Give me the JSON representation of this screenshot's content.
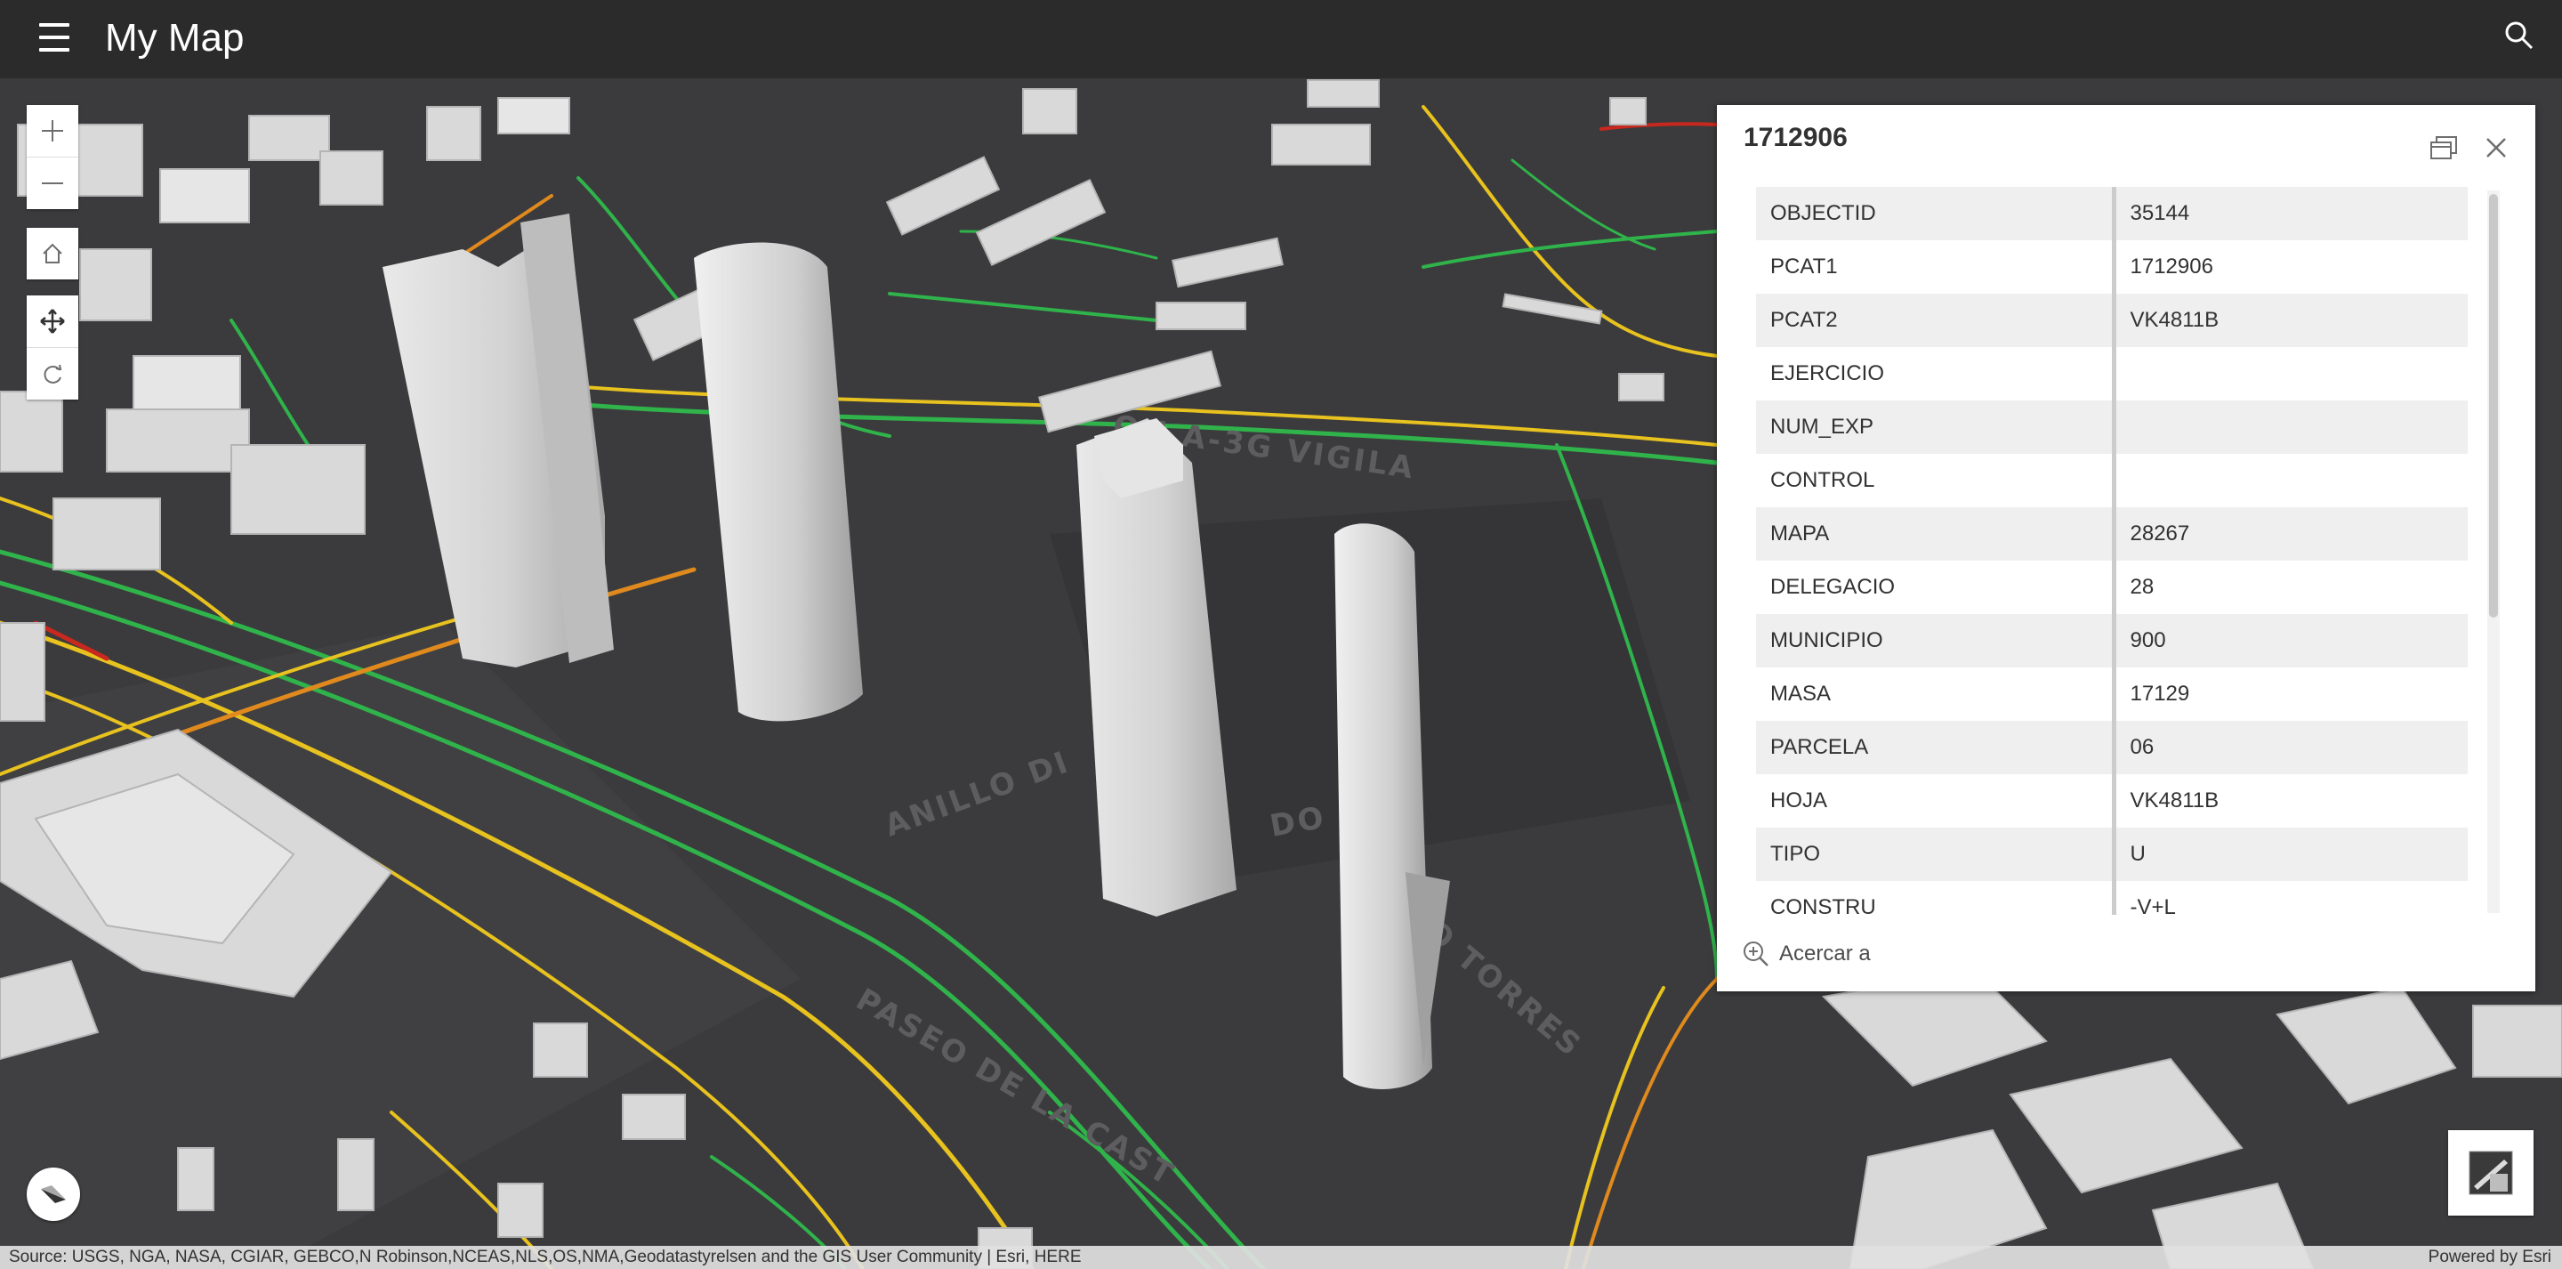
{
  "header": {
    "title": "My Map"
  },
  "popup": {
    "title": "1712906",
    "zoom_label": "Acercar a",
    "rows": [
      {
        "key": "OBJECTID",
        "value": "35144"
      },
      {
        "key": "PCAT1",
        "value": "1712906"
      },
      {
        "key": "PCAT2",
        "value": "VK4811B"
      },
      {
        "key": "EJERCICIO",
        "value": ""
      },
      {
        "key": "NUM_EXP",
        "value": ""
      },
      {
        "key": "CONTROL",
        "value": ""
      },
      {
        "key": "MAPA",
        "value": "28267"
      },
      {
        "key": "DELEGACIO",
        "value": "28"
      },
      {
        "key": "MUNICIPIO",
        "value": "900"
      },
      {
        "key": "MASA",
        "value": "17129"
      },
      {
        "key": "PARCELA",
        "value": "06"
      },
      {
        "key": "HOJA",
        "value": "VK4811B"
      },
      {
        "key": "TIPO",
        "value": "U"
      },
      {
        "key": "CONSTRU",
        "value": "-V+L"
      }
    ]
  },
  "map": {
    "labels": {
      "anillo": "ANILLO DI",
      "dor": "DO R",
      "torres": "O TORRES",
      "paseo": "PASEO DE LA CAST",
      "top_road": "ON A-3G VIGILA"
    }
  },
  "attribution": {
    "source": "Source: USGS, NGA, NASA, CGIAR, GEBCO,N Robinson,NCEAS,NLS,OS,NMA,Geodatastyrelsen and the GIS User Community | Esri, HERE",
    "powered": "Powered by Esri"
  },
  "colors": {
    "header_bg": "#2b2b2b",
    "map_bg": "#3b3b3d",
    "traffic_green": "#2fb34a",
    "traffic_yellow": "#e8c21e",
    "traffic_orange": "#e08a1e",
    "traffic_red": "#c8281e"
  },
  "icons": [
    "menu-icon",
    "search-icon",
    "zoom-in-icon",
    "zoom-out-icon",
    "home-icon",
    "pan-icon",
    "rotate-icon",
    "dock-icon",
    "close-icon",
    "zoom-to-icon",
    "compass-icon",
    "basemap-icon"
  ]
}
